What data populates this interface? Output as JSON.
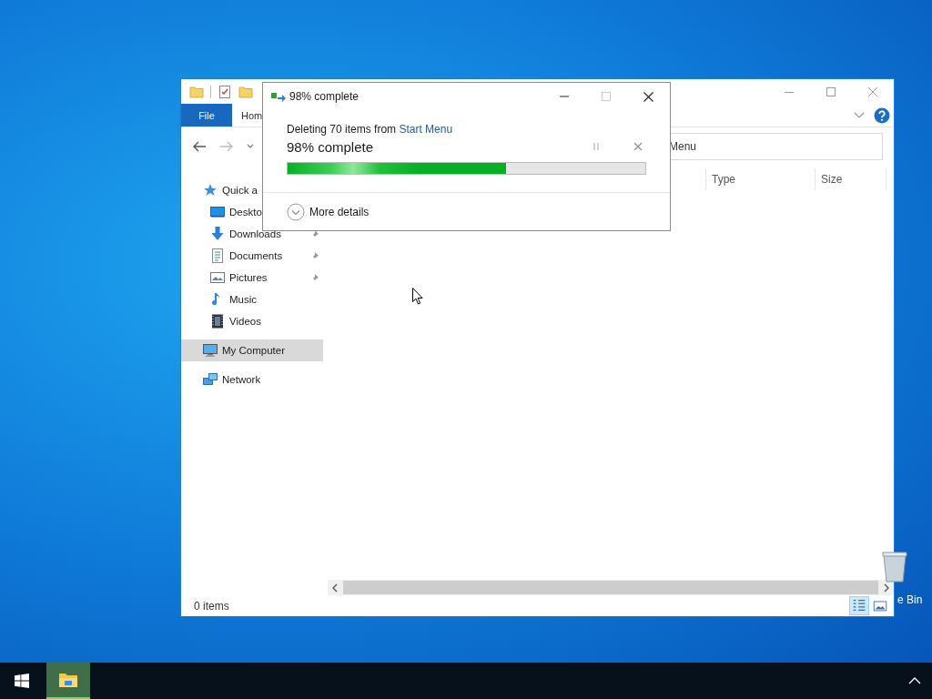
{
  "desktop": {
    "icons": [
      {
        "kind": "recycle_bin",
        "label": "e Bin"
      }
    ]
  },
  "explorer": {
    "quick_access_toolbar": [
      {
        "kind": "folder"
      },
      {
        "kind": "properties"
      },
      {
        "kind": "folder"
      }
    ],
    "ribbon_tabs": [
      {
        "label": "File",
        "kind": "file"
      },
      {
        "label": "Hom",
        "kind": "tab"
      }
    ],
    "address": {
      "value": "Menu"
    },
    "columns": [
      {
        "label": "Type"
      },
      {
        "label": "Size"
      }
    ],
    "navigation": [
      {
        "label": "Quick a",
        "kind": "star",
        "pinned": false,
        "selected": false,
        "children": [
          {
            "label": "Deskto",
            "kind": "desktop",
            "pinned": false,
            "selected": false
          },
          {
            "label": "Downloads",
            "kind": "download",
            "pinned": true,
            "selected": false
          },
          {
            "label": "Documents",
            "kind": "document",
            "pinned": true,
            "selected": false
          },
          {
            "label": "Pictures",
            "kind": "picture",
            "pinned": true,
            "selected": false
          },
          {
            "label": "Music",
            "kind": "music",
            "pinned": false,
            "selected": false
          },
          {
            "label": "Videos",
            "kind": "video",
            "pinned": false,
            "selected": false
          }
        ]
      },
      {
        "label": "My Computer",
        "kind": "computer",
        "pinned": false,
        "selected": true
      },
      {
        "label": "Network",
        "kind": "network",
        "pinned": false,
        "selected": false
      }
    ],
    "status_bar": {
      "item_count": "0 items"
    },
    "view_buttons": [
      {
        "kind": "details",
        "selected": true
      },
      {
        "kind": "large_icons",
        "selected": false
      }
    ]
  },
  "dialog": {
    "title": "98% complete",
    "maximize_disabled": true,
    "operation": "Deleting 70 items from ",
    "source_link": "Start Menu",
    "heading": "98% complete",
    "level": 0.61,
    "details_label": "More details"
  },
  "taskbar": {
    "buttons": [
      {
        "kind": "start",
        "active": false
      },
      {
        "kind": "explorer",
        "active": true
      }
    ]
  }
}
